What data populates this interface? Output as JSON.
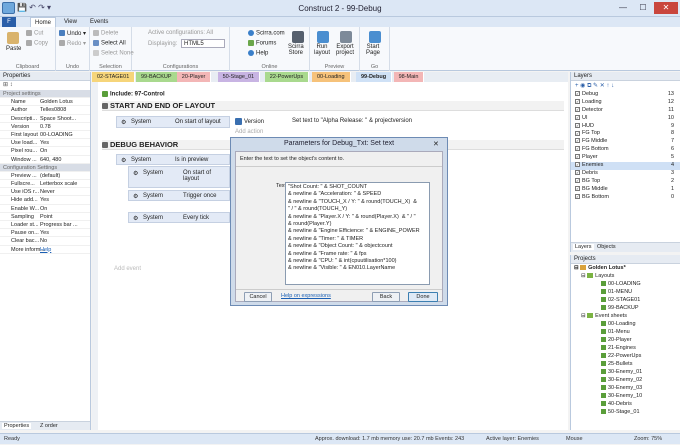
{
  "window": {
    "title": "Construct 2 - 99-Debug",
    "min": "—",
    "max": "☐",
    "close": "✕"
  },
  "ribbon_tabs": {
    "file": "F",
    "home": "Home",
    "view": "View",
    "events": "Events"
  },
  "ribbon": {
    "paste": "Paste",
    "cut": "Cut",
    "copy": "Copy",
    "undo": "Undo",
    "redo": "Redo",
    "delete": "Delete",
    "select_all": "Select All",
    "select_none": "Select None",
    "active_configs": "Active configurations: All",
    "displaying": "Displaying:",
    "displaying_value": "HTML5",
    "scirra_com": "Scirra.com",
    "forums": "Forums",
    "help": "Help",
    "store": "Scirra\nStore",
    "run_layout": "Run\nlayout",
    "export_project": "Export\nproject",
    "start_page": "Start\nPage",
    "groups": {
      "clipboard": "Clipboard",
      "undo": "Undo",
      "selection": "Selection",
      "configurations": "Configurations",
      "online": "Online",
      "preview": "Preview",
      "project": "Project",
      "go": "Go"
    }
  },
  "layout_tabs": [
    "02-STAGE01",
    "99-BACKUP",
    "20-Player",
    "50-Stage_01",
    "22-PowerUps",
    "00-Loading",
    "99-Debug",
    "98-Main"
  ],
  "properties": {
    "title": "Properties",
    "project_header": "Project settings",
    "rows": [
      [
        "Name",
        "Golden Lotus"
      ],
      [
        "Author",
        "Telles0808"
      ],
      [
        "Descripti...",
        "Space Shoot..."
      ],
      [
        "Version",
        "0.78"
      ],
      [
        "First layout",
        "00-LOADING"
      ],
      [
        "Use load...",
        "Yes"
      ],
      [
        "Pixel rou...",
        "On"
      ],
      [
        "Window ...",
        "640, 480"
      ]
    ],
    "config_header": "Configuration Settings",
    "rows2": [
      [
        "Preview ...",
        "(default)"
      ],
      [
        "Fullscre...",
        "Letterbox scale"
      ],
      [
        "Use iOS r...",
        "Never"
      ],
      [
        "Hide add...",
        "Yes"
      ],
      [
        "Enable W...",
        "On"
      ],
      [
        "Sampling",
        "Point"
      ],
      [
        "Loader st...",
        "Progress bar ..."
      ],
      [
        "Pause on...",
        "Yes"
      ],
      [
        "Clear bac...",
        "No"
      ],
      [
        "More inform...",
        "Help"
      ]
    ],
    "bottom_tabs": [
      "Properties",
      "Z order"
    ]
  },
  "events": {
    "include": "Include: 97-Control",
    "group1": "START AND END OF LAYOUT",
    "g1_system": "System",
    "g1_cond": "On start of layout",
    "g1_action": "Set text to \"Alpha Release: \" & projectversion",
    "g1_obj": "Version",
    "add_action": "Add action",
    "group2": "DEBUG BEHAVIOR",
    "g2_system": "System",
    "g2_cond": "Is in preview",
    "sub1_cond": "On start of layout",
    "sub2_cond": "Trigger once",
    "sub3_cond": "Every tick",
    "add_event": "Add event"
  },
  "dialog": {
    "title": "Parameters for Debug_Txt: Set text",
    "prompt": "Enter the text to set the object's content to.",
    "text_label": "Text",
    "expression": "\"Shot Count: \" & SHOT_COUNT\n& newline & \"Acceleration: \" & SPEED\n& newline & \"TOUCH_X / Y: \" & round(TOUCH_X)  &\n\" / \" & round(TOUCH_Y)\n& newline & \"Player.X / Y: \" & round(Player.X)  & \" / \"\n& round(Player.Y)\n& newline & \"Engine Efficience: \" & ENGINE_POWER\n& newline & \"Timer: \" & TIMER\n& newline & \"Object Count: \" & objectcount\n& newline & \"Frame rate: \" & fps\n& newline & \"CPU: \" & int(cpuutilisation*100)\n& newline & \"Visible: \" & EN010.LayerName",
    "cancel": "Cancel",
    "help_link": "Help on expressions",
    "back": "Back",
    "done": "Done"
  },
  "layers": {
    "title": "Layers",
    "rows": [
      [
        "Debug",
        "13"
      ],
      [
        "Loading",
        "12"
      ],
      [
        "Detector",
        "11"
      ],
      [
        "UI",
        "10"
      ],
      [
        "HUD",
        "9"
      ],
      [
        "FG Top",
        "8"
      ],
      [
        "FG Middle",
        "7"
      ],
      [
        "FG Bottom",
        "6"
      ],
      [
        "Player",
        "5"
      ],
      [
        "Enemies",
        "4"
      ],
      [
        "Debris",
        "3"
      ],
      [
        "BG Top",
        "2"
      ],
      [
        "BG Middle",
        "1"
      ],
      [
        "BG Bottom",
        "0"
      ]
    ],
    "tabs": [
      "Layers",
      "Objects"
    ]
  },
  "projects": {
    "title": "Projects",
    "root": "Golden Lotus*",
    "layouts_label": "Layouts",
    "layouts": [
      "00-LOADING",
      "01-MENU",
      "02-STAGE01",
      "99-BACKUP"
    ],
    "sheets_label": "Event sheets",
    "sheets": [
      "00-Loading",
      "01-Menu",
      "20-Player",
      "21-Engines",
      "22-PowerUps",
      "25-Bullets",
      "30-Enemy_01",
      "30-Enemy_02",
      "30-Enemy_03",
      "30-Enemy_10",
      "40-Debris",
      "50-Stage_01"
    ]
  },
  "status": {
    "ready": "Ready",
    "download": "Approx. download: 1.7 mb  memory use: 20.7 mb  Events: 243",
    "layer": "Active layer: Enemies",
    "mouse": "Mouse",
    "zoom": "Zoom: 75%"
  },
  "colors": {
    "accent": "#2a5ea8",
    "active_tab": "#ffffff"
  }
}
